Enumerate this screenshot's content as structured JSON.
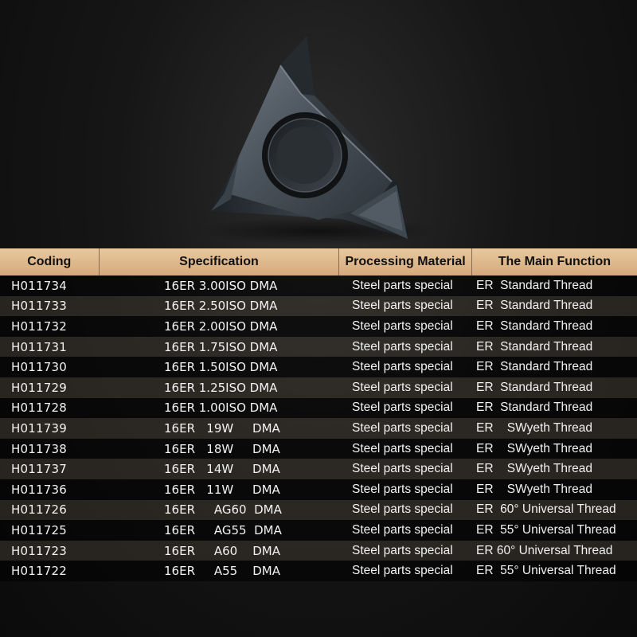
{
  "table": {
    "headers": {
      "coding": "Coding",
      "specification": "Specification",
      "material": "Processing Material",
      "function": "The Main Function"
    },
    "rows": [
      {
        "code": "H011734",
        "spec": "16ER 3.00ISO DMA",
        "material": "Steel parts special",
        "function": "ER  Standard Thread"
      },
      {
        "code": "H011733",
        "spec": "16ER 2.50ISO DMA",
        "material": "Steel parts special",
        "function": "ER  Standard Thread"
      },
      {
        "code": "H011732",
        "spec": "16ER 2.00ISO DMA",
        "material": "Steel parts special",
        "function": "ER  Standard Thread"
      },
      {
        "code": "H011731",
        "spec": "16ER 1.75ISO DMA",
        "material": "Steel parts special",
        "function": "ER  Standard Thread"
      },
      {
        "code": "H011730",
        "spec": "16ER 1.50ISO DMA",
        "material": "Steel parts special",
        "function": "ER  Standard Thread"
      },
      {
        "code": "H011729",
        "spec": "16ER 1.25ISO DMA",
        "material": "Steel parts special",
        "function": "ER  Standard Thread"
      },
      {
        "code": "H011728",
        "spec": "16ER 1.00ISO DMA",
        "material": "Steel parts special",
        "function": "ER  Standard Thread"
      },
      {
        "code": "H011739",
        "spec": "16ER   19W     DMA",
        "material": "Steel parts special",
        "function": "ER    SWyeth Thread"
      },
      {
        "code": "H011738",
        "spec": "16ER   18W     DMA",
        "material": "Steel parts special",
        "function": "ER    SWyeth Thread"
      },
      {
        "code": "H011737",
        "spec": "16ER   14W     DMA",
        "material": "Steel parts special",
        "function": "ER    SWyeth Thread"
      },
      {
        "code": "H011736",
        "spec": "16ER   11W     DMA",
        "material": "Steel parts special",
        "function": "ER    SWyeth Thread"
      },
      {
        "code": "H011726",
        "spec": "16ER     AG60  DMA",
        "material": "Steel parts special",
        "function": "ER  60° Universal Thread"
      },
      {
        "code": "H011725",
        "spec": "16ER     AG55  DMA",
        "material": "Steel parts special",
        "function": "ER  55° Universal Thread"
      },
      {
        "code": "H011723",
        "spec": "16ER     A60    DMA",
        "material": "Steel parts special",
        "function": "ER 60° Universal Thread"
      },
      {
        "code": "H011722",
        "spec": "16ER     A55    DMA",
        "material": "Steel parts special",
        "function": "ER  55° Universal Thread"
      }
    ]
  }
}
